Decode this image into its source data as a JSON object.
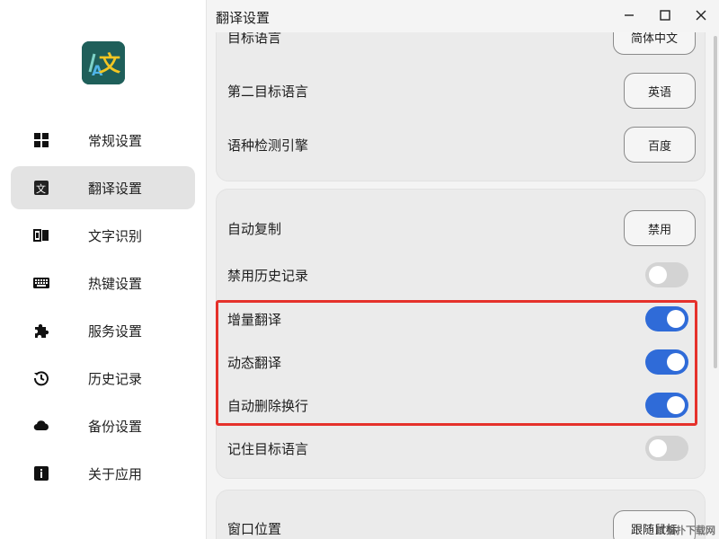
{
  "window": {
    "title": "翻译设置",
    "minimize_icon": "minimize-icon",
    "maximize_icon": "maximize-icon",
    "close_icon": "close-icon"
  },
  "sidebar": {
    "logo_icon": "translate-logo-icon",
    "items": [
      {
        "label": "常规设置",
        "icon": "grid-icon",
        "active": false
      },
      {
        "label": "翻译设置",
        "icon": "translate-icon",
        "active": true
      },
      {
        "label": "文字识别",
        "icon": "ocr-icon",
        "active": false
      },
      {
        "label": "热键设置",
        "icon": "keyboard-icon",
        "active": false
      },
      {
        "label": "服务设置",
        "icon": "puzzle-icon",
        "active": false
      },
      {
        "label": "历史记录",
        "icon": "history-icon",
        "active": false
      },
      {
        "label": "备份设置",
        "icon": "cloud-icon",
        "active": false
      },
      {
        "label": "关于应用",
        "icon": "info-icon",
        "active": false
      }
    ]
  },
  "settings": {
    "language_card": {
      "target_language": {
        "label": "目标语言",
        "value": "简体中文"
      },
      "second_target_language": {
        "label": "第二目标语言",
        "value": "英语"
      },
      "detect_engine": {
        "label": "语种检测引擎",
        "value": "百度"
      }
    },
    "behavior_card": {
      "auto_copy": {
        "label": "自动复制",
        "value": "禁用"
      },
      "disable_history": {
        "label": "禁用历史记录",
        "enabled": false
      },
      "incremental_translate": {
        "label": "增量翻译",
        "enabled": true
      },
      "dynamic_translate": {
        "label": "动态翻译",
        "enabled": true
      },
      "auto_remove_newline": {
        "label": "自动删除换行",
        "enabled": true
      },
      "remember_target_language": {
        "label": "记住目标语言",
        "enabled": false
      }
    },
    "window_card": {
      "window_position": {
        "label": "窗口位置",
        "value": "跟随鼠标"
      }
    }
  },
  "watermark": "IT猫扑下载网",
  "colors": {
    "toggle_on": "#2f6bd8",
    "toggle_off": "#d3d3d3",
    "highlight_border": "#e5312b",
    "active_nav": "#e3e3e3"
  }
}
